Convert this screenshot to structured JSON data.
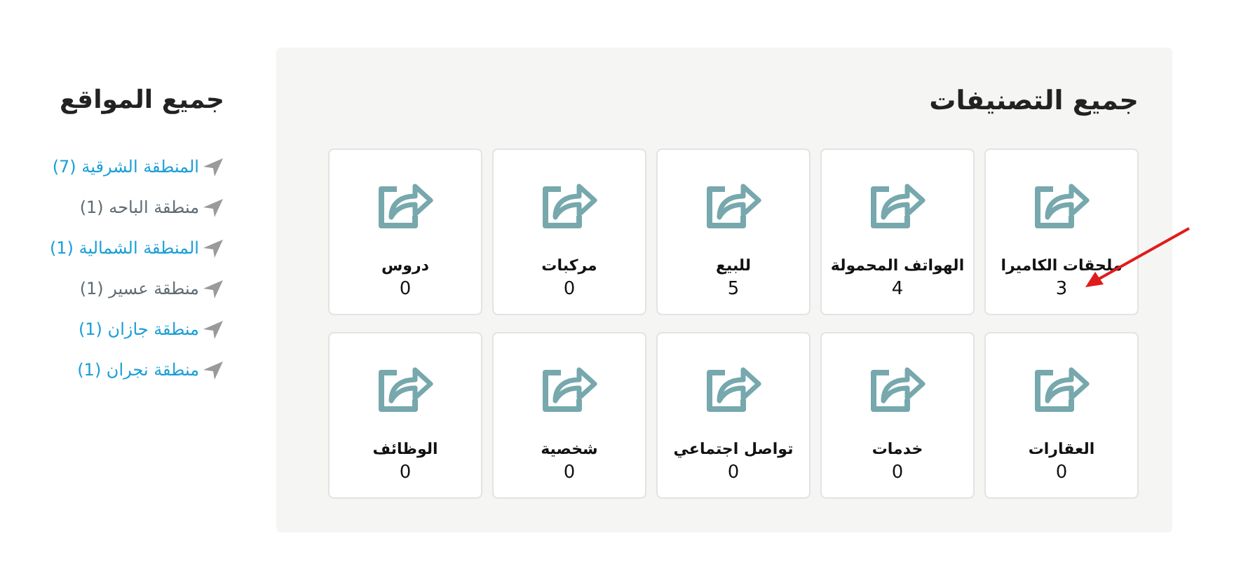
{
  "categories": {
    "title": "جميع التصنيفات",
    "items": [
      {
        "label": "ملحقات الكاميرا",
        "count": "3"
      },
      {
        "label": "الهواتف المحمولة",
        "count": "4"
      },
      {
        "label": "للبيع",
        "count": "5"
      },
      {
        "label": "مركبات",
        "count": "0"
      },
      {
        "label": "دروس",
        "count": "0"
      },
      {
        "label": "العقارات",
        "count": "0"
      },
      {
        "label": "خدمات",
        "count": "0"
      },
      {
        "label": "تواصل اجتماعي",
        "count": "0"
      },
      {
        "label": "شخصية",
        "count": "0"
      },
      {
        "label": "الوظائف",
        "count": "0"
      }
    ]
  },
  "locations": {
    "title": "جميع المواقع",
    "items": [
      {
        "label": "المنطقة الشرقية (7)",
        "visited": false
      },
      {
        "label": "منطقة الباحه (1)",
        "visited": true
      },
      {
        "label": "المنطقة الشمالية (1)",
        "visited": false
      },
      {
        "label": "منطقة عسير (1)",
        "visited": true
      },
      {
        "label": "منطقة جازان (1)",
        "visited": false
      },
      {
        "label": "منطقة نجران (1)",
        "visited": false
      }
    ]
  }
}
